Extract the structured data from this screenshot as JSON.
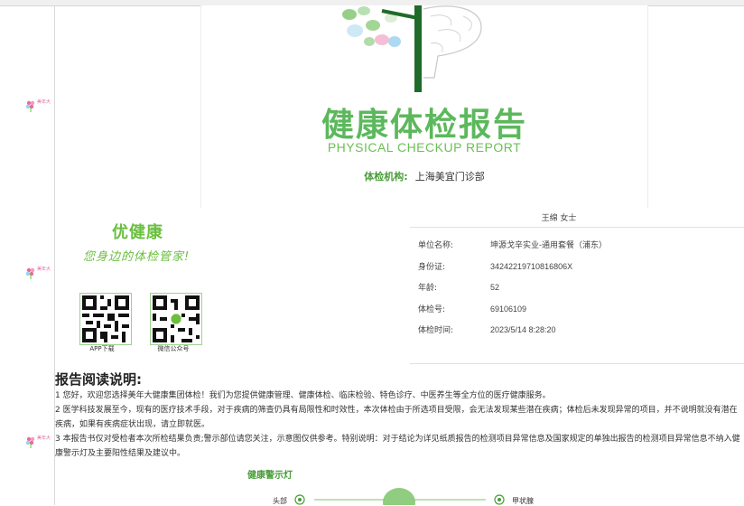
{
  "brand_watermark": "美年大",
  "cover": {
    "title": "健康体检报告",
    "subtitle": "PHYSICAL CHECKUP REPORT",
    "org_label": "体检机构:",
    "org_value": "上海美宜门诊部"
  },
  "brand": {
    "name": "优健康",
    "slogan": "您身边的体检管家!",
    "qr": [
      {
        "caption": "APP下载"
      },
      {
        "caption": "微信公众号"
      }
    ]
  },
  "patient": {
    "name": "王绵 女士",
    "fields": [
      {
        "label": "单位名称:",
        "value": "坤源戈辛实业-通用套餐（浦东）"
      },
      {
        "label": "身份证:",
        "value": "34242219710816806X"
      },
      {
        "label": "年龄:",
        "value": "52"
      },
      {
        "label": "体检号:",
        "value": "69106109"
      },
      {
        "label": "体检时间:",
        "value": "2023/5/14 8:28:20"
      }
    ]
  },
  "notes": {
    "heading": "报告阅读说明:",
    "items": [
      "1 您好，欢迎您选择美年大健康集团体检！我们为您提供健康管理、健康体检、临床检验、特色诊疗、中医养生等全方位的医疗健康服务。",
      "2 医学科技发展至今，现有的医疗技术手段，对于疾病的筛查仍具有局限性和时效性，本次体检由于所选项目受限，会无法发现某些潜在疾病；体检后未发现异常的项目，并不说明就没有潜在疾病，如果有疾病症状出现，请立即就医。",
      "3 本报告书仅对受检者本次所检结果负责;警示部位请您关注，示意图仅供参考。特别说明：对于结论为详见纸质报告的检测项目异常信息及国家规定的单独出报告的检测项目异常信息不纳入健康警示灯及主要阳性结果及建议中。"
    ]
  },
  "warning_light": {
    "title": "健康警示灯",
    "labels": [
      "头部",
      "甲状腺"
    ]
  },
  "colors": {
    "green": "#5cb85c",
    "dark_green": "#1f6b2a",
    "pink": "#e86aa0"
  }
}
